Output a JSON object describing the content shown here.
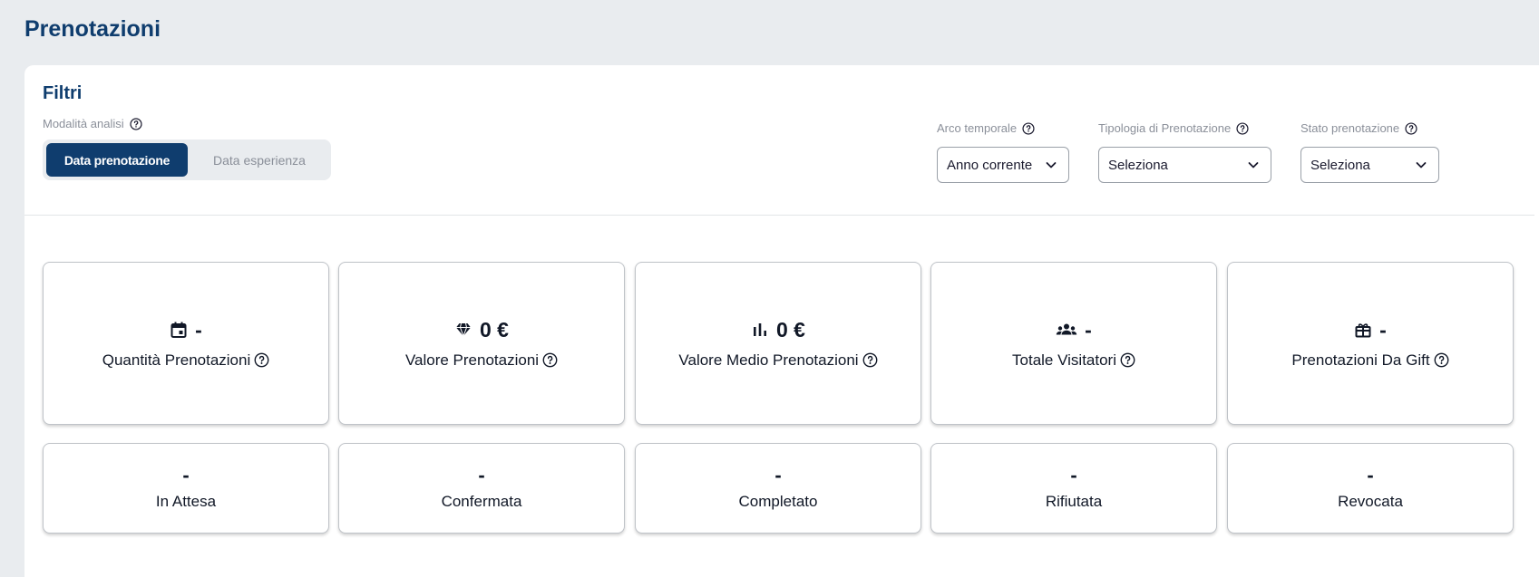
{
  "page": {
    "title": "Prenotazioni"
  },
  "filters": {
    "title": "Filtri",
    "analysis_mode": {
      "label": "Modalità analisi",
      "options": [
        "Data prenotazione",
        "Data esperienza"
      ],
      "selected": "Data prenotazione"
    },
    "time_range": {
      "label": "Arco temporale",
      "value": "Anno corrente"
    },
    "booking_type": {
      "label": "Tipologia di Prenotazione",
      "value": "Seleziona"
    },
    "booking_status": {
      "label": "Stato prenotazione",
      "value": "Seleziona"
    }
  },
  "kpis": [
    {
      "icon": "calendar-icon",
      "value": "-",
      "label": "Quantità Prenotazioni"
    },
    {
      "icon": "diamond-icon",
      "value": "0 €",
      "label": "Valore Prenotazioni"
    },
    {
      "icon": "bar-chart-icon",
      "value": "0 €",
      "label": "Valore Medio Prenotazioni"
    },
    {
      "icon": "group-icon",
      "value": "-",
      "label": "Totale Visitatori"
    },
    {
      "icon": "gift-icon",
      "value": "-",
      "label": "Prenotazioni Da Gift"
    }
  ],
  "statuses": [
    {
      "value": "-",
      "label": "In Attesa"
    },
    {
      "value": "-",
      "label": "Confermata"
    },
    {
      "value": "-",
      "label": "Completato"
    },
    {
      "value": "-",
      "label": "Rifiutata"
    },
    {
      "value": "-",
      "label": "Revocata"
    }
  ],
  "colors": {
    "primary": "#0f3d6e",
    "muted_text": "#8a8f99",
    "background": "#e9ecef"
  }
}
